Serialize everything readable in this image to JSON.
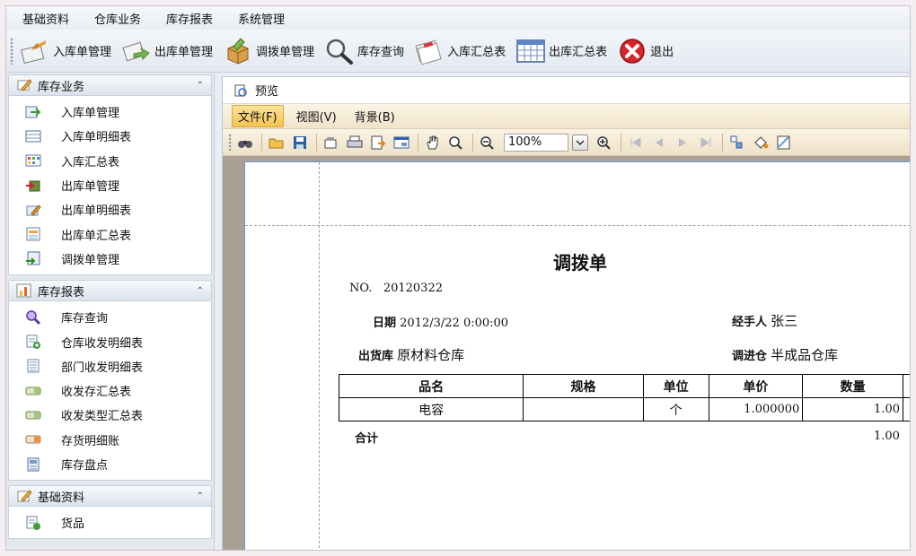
{
  "menubar": [
    "基础资料",
    "仓库业务",
    "库存报表",
    "系统管理"
  ],
  "toolbar": [
    {
      "label": "入库单管理",
      "icon": "inbound-doc-icon"
    },
    {
      "label": "出库单管理",
      "icon": "outbound-doc-icon"
    },
    {
      "label": "调拨单管理",
      "icon": "transfer-box-icon"
    },
    {
      "label": "库存查询",
      "icon": "magnifier-icon"
    },
    {
      "label": "入库汇总表",
      "icon": "calendar-stack-icon"
    },
    {
      "label": "出库汇总表",
      "icon": "grid-table-icon"
    },
    {
      "label": "退出",
      "icon": "close-red-icon"
    }
  ],
  "sidebar": {
    "groups": [
      {
        "title": "库存业务",
        "items": [
          "入库单管理",
          "入库单明细表",
          "入库汇总表",
          "出库单管理",
          "出库单明细表",
          "出库单汇总表",
          "调拨单管理"
        ]
      },
      {
        "title": "库存报表",
        "items": [
          "库存查询",
          "仓库收发明细表",
          "部门收发明细表",
          "收发存汇总表",
          "收发类型汇总表",
          "存货明细账",
          "库存盘点"
        ]
      },
      {
        "title": "基础资料",
        "items": [
          "货品"
        ]
      }
    ]
  },
  "preview": {
    "title": "预览",
    "menu": [
      "文件(F)",
      "视图(V)",
      "背景(B)"
    ],
    "zoom": "100%"
  },
  "document": {
    "title": "调拨单",
    "no_label": "NO.",
    "no_value": "20120322",
    "date_label": "日期",
    "date_value": "2012/3/22 0:00:00",
    "handler_label": "经手人",
    "handler_value": "张三",
    "out_label": "出货库",
    "out_value": "原材料仓库",
    "in_label": "调进仓",
    "in_value": "半成品仓库",
    "columns": [
      "品名",
      "规格",
      "单位",
      "单价",
      "数量"
    ],
    "rows": [
      {
        "name": "电容",
        "spec": "",
        "unit": "个",
        "price": "1.000000",
        "qty": "1.00"
      }
    ],
    "total_label": "合计",
    "total_value": "1.00"
  },
  "colors": {
    "accent": "#f6c453",
    "canvas": "#a99f95",
    "sidebar": "#e4e9f0"
  }
}
